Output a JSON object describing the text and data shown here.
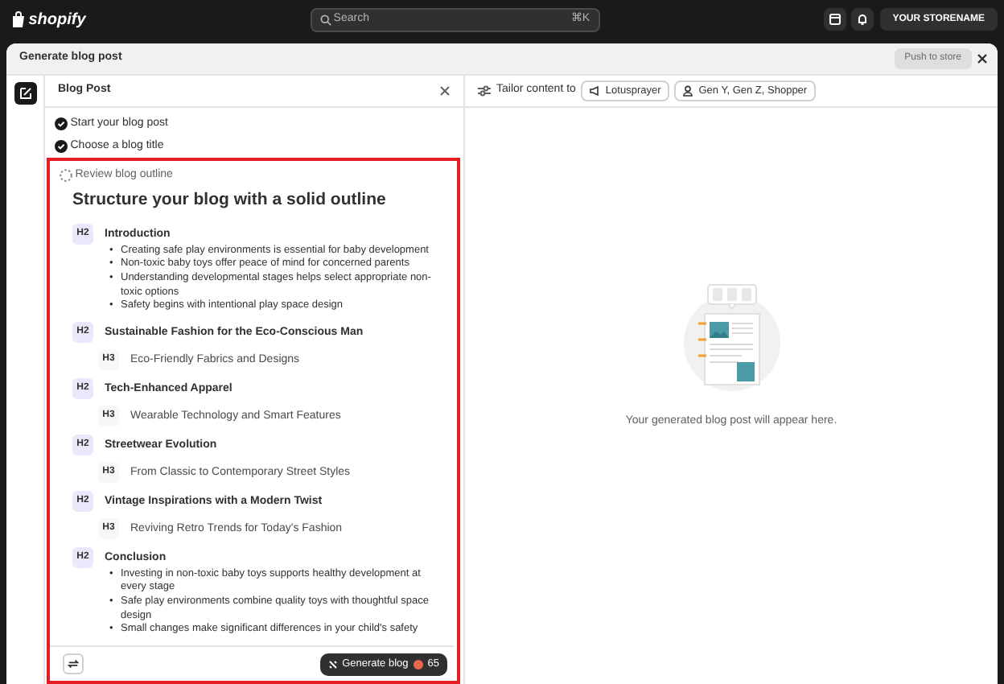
{
  "topbar": {
    "logo": "shopify",
    "search": {
      "placeholder": "Search",
      "shortcut": "⌘K"
    },
    "store_button": "YOUR STORENAME"
  },
  "modal": {
    "title": "Generate blog post",
    "push_button": {
      "label": "Push to store",
      "disabled": true
    }
  },
  "left_panel": {
    "title": "Blog Post",
    "steps": [
      {
        "label": "Start your blog post",
        "completed": true,
        "highlighted": false
      },
      {
        "label": "Choose a blog title",
        "completed": true,
        "highlighted": false
      },
      {
        "label": "Review blog outline",
        "completed": false,
        "highlighted": true
      }
    ],
    "outline": {
      "heading": "Structure your blog with a solid outline",
      "bullet_marker": "•",
      "sections": [
        {
          "tag": "H2",
          "title": "Introduction",
          "bullets": [
            "Creating safe play environments is essential for baby development",
            "Non-toxic baby toys offer peace of mind for concerned parents",
            "Understanding developmental stages helps select appropriate non-toxic options",
            "Safety begins with intentional play space design"
          ]
        },
        {
          "tag": "H2",
          "title": "Sustainable Fashion for the Eco-Conscious Man",
          "children": [
            {
              "tag": "H3",
              "title": "Eco-Friendly Fabrics and Designs"
            }
          ]
        },
        {
          "tag": "H2",
          "title": "Tech-Enhanced Apparel",
          "children": [
            {
              "tag": "H3",
              "title": "Wearable Technology and Smart Features"
            }
          ]
        },
        {
          "tag": "H2",
          "title": "Streetwear Evolution",
          "children": [
            {
              "tag": "H3",
              "title": "From Classic to Contemporary Street Styles"
            }
          ]
        },
        {
          "tag": "H2",
          "title": "Vintage Inspirations with a Modern Twist",
          "children": [
            {
              "tag": "H3",
              "title": "Reviving Retro Trends for Today's Fashion"
            }
          ]
        },
        {
          "tag": "H2",
          "title": "Conclusion",
          "bullets": [
            "Investing in non-toxic baby toys supports healthy development at every stage",
            "Safe play environments combine quality toys with thoughtful space design",
            "Small changes make significant differences in your child's safety"
          ]
        }
      ]
    },
    "generate_button": {
      "label": "Generate blog",
      "credits": "65"
    }
  },
  "right_panel": {
    "tailor_label": "Tailor content to",
    "chips": [
      {
        "kind": "brand",
        "label": "Lotusprayer"
      },
      {
        "kind": "audience",
        "label": "Gen Y, Gen Z, Shopper"
      }
    ],
    "empty_message": "Your generated blog post will appear here."
  }
}
